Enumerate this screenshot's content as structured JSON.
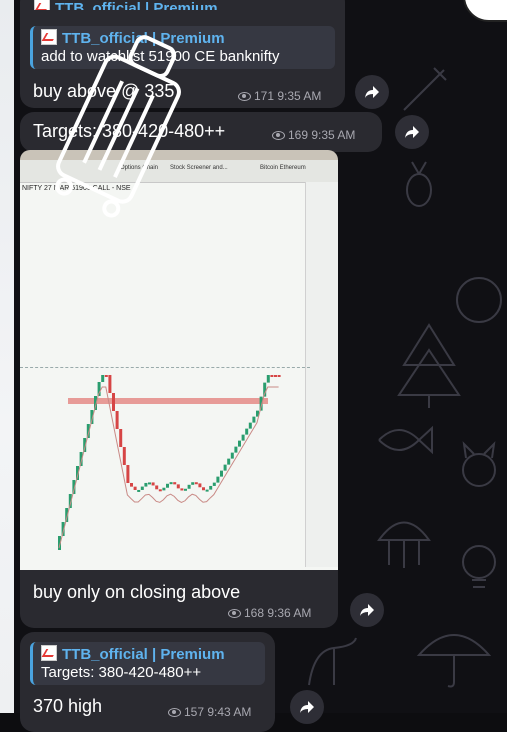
{
  "messages": [
    {
      "quote_author": "TTB_official | Premium",
      "quote_text": "add to watchlist 51900 CE banknifty",
      "text": "buy above @ 335",
      "views": "171",
      "time": "9:35 AM"
    },
    {
      "text": "Targets: 380-420-480++",
      "views": "169",
      "time": "9:35 AM"
    },
    {
      "photo_caption": "buy only on closing above",
      "views": "168",
      "time": "9:36 AM"
    },
    {
      "quote_author": "TTB_official | Premium",
      "quote_text": "Targets: 380-420-480++",
      "text": "370 high",
      "views": "157",
      "time": "9:43 AM"
    }
  ],
  "top_header_partial": "TTB_official | Premium",
  "chart_photo": {
    "symbol_text": "NIFTY 27 MAR 51900 CALL - NSE",
    "tabs": [
      "Stock Screener and...",
      "Options Chain",
      "Bitcoin Ethereum"
    ]
  },
  "icons": [
    "forward-icon",
    "eye-icon",
    "chart-emoji-icon",
    "suitcase-sticker"
  ],
  "colors": {
    "bubble": "#2a2a30",
    "quote_accent": "#4aa3df",
    "quote_title": "#5fb3ee",
    "meta": "#a8a8b0"
  }
}
